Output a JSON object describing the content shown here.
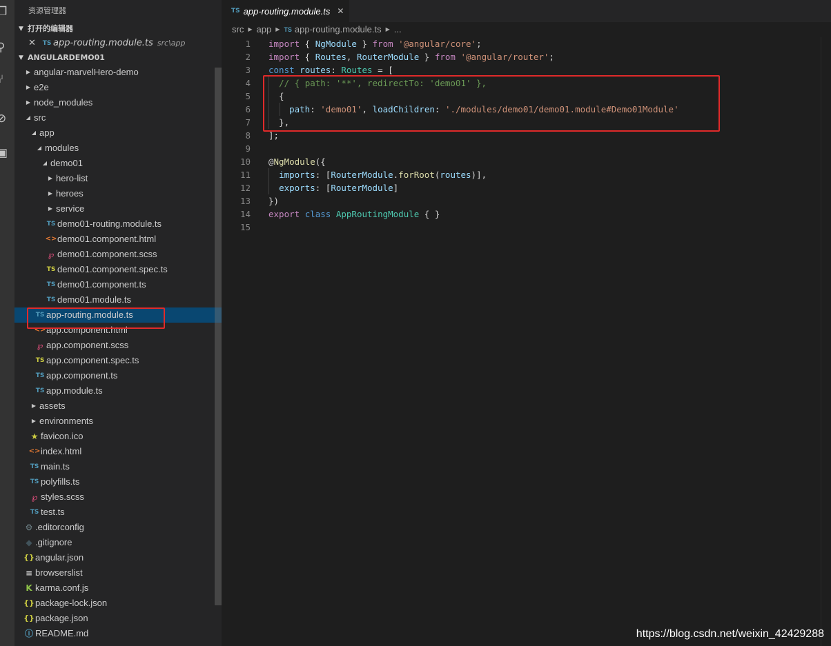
{
  "sidebar": {
    "title": "资源管理器",
    "open_editors_label": "打开的编辑器",
    "open_editor": {
      "name": "app-routing.module.ts",
      "path": "src\\app"
    },
    "project_label": "ANGULARDEMO01"
  },
  "tree": [
    {
      "name": "angular-marvelHero-demo",
      "type": "folder",
      "open": false
    },
    {
      "name": "e2e",
      "type": "folder",
      "open": false
    },
    {
      "name": "node_modules",
      "type": "folder",
      "open": false
    },
    {
      "name": "src",
      "type": "folder",
      "open": true
    },
    {
      "name": "app",
      "type": "folder",
      "open": true
    },
    {
      "name": "modules",
      "type": "folder",
      "open": true
    },
    {
      "name": "demo01",
      "type": "folder",
      "open": true
    },
    {
      "name": "hero-list",
      "type": "folder",
      "open": false
    },
    {
      "name": "heroes",
      "type": "folder",
      "open": false
    },
    {
      "name": "service",
      "type": "folder",
      "open": false
    },
    {
      "name": "demo01-routing.module.ts",
      "type": "ts"
    },
    {
      "name": "demo01.component.html",
      "type": "html"
    },
    {
      "name": "demo01.component.scss",
      "type": "scss"
    },
    {
      "name": "demo01.component.spec.ts",
      "type": "tsspec"
    },
    {
      "name": "demo01.component.ts",
      "type": "ts"
    },
    {
      "name": "demo01.module.ts",
      "type": "ts"
    },
    {
      "name": "app-routing.module.ts",
      "type": "ts",
      "selected": true
    },
    {
      "name": "app.component.html",
      "type": "html"
    },
    {
      "name": "app.component.scss",
      "type": "scss"
    },
    {
      "name": "app.component.spec.ts",
      "type": "tsspec"
    },
    {
      "name": "app.component.ts",
      "type": "ts"
    },
    {
      "name": "app.module.ts",
      "type": "ts"
    },
    {
      "name": "assets",
      "type": "folder",
      "open": false
    },
    {
      "name": "environments",
      "type": "folder",
      "open": false
    },
    {
      "name": "favicon.ico",
      "type": "fav"
    },
    {
      "name": "index.html",
      "type": "html"
    },
    {
      "name": "main.ts",
      "type": "ts"
    },
    {
      "name": "polyfills.ts",
      "type": "ts"
    },
    {
      "name": "styles.scss",
      "type": "scss"
    },
    {
      "name": "test.ts",
      "type": "ts"
    },
    {
      "name": ".editorconfig",
      "type": "gear"
    },
    {
      "name": ".gitignore",
      "type": "git"
    },
    {
      "name": "angular.json",
      "type": "json"
    },
    {
      "name": "browserslist",
      "type": "list"
    },
    {
      "name": "karma.conf.js",
      "type": "karma"
    },
    {
      "name": "package-lock.json",
      "type": "json"
    },
    {
      "name": "package.json",
      "type": "json"
    },
    {
      "name": "README.md",
      "type": "info"
    }
  ],
  "icons": {
    "ts": "TS",
    "tsspec": "TS",
    "html": "<>",
    "scss": "℘",
    "json": "{}",
    "fav": "★",
    "gear": "⚙",
    "git": "◆",
    "list": "≡",
    "karma": "K",
    "info": "ⓘ"
  },
  "tab": {
    "label": "app-routing.module.ts",
    "icon": "TS"
  },
  "breadcrumb": [
    "src",
    "app",
    "app-routing.module.ts",
    "..."
  ],
  "code_lines": [
    [
      [
        "kw",
        "import"
      ],
      [
        "pn",
        " { "
      ],
      [
        "var",
        "NgModule"
      ],
      [
        "pn",
        " } "
      ],
      [
        "kw",
        "from"
      ],
      [
        "pn",
        " "
      ],
      [
        "str",
        "'@angular/core'"
      ],
      [
        "pn",
        ";"
      ]
    ],
    [
      [
        "kw",
        "import"
      ],
      [
        "pn",
        " { "
      ],
      [
        "var",
        "Routes"
      ],
      [
        "pn",
        ", "
      ],
      [
        "var",
        "RouterModule"
      ],
      [
        "pn",
        " } "
      ],
      [
        "kw",
        "from"
      ],
      [
        "pn",
        " "
      ],
      [
        "str",
        "'@angular/router'"
      ],
      [
        "pn",
        ";"
      ]
    ],
    [
      [
        "kb",
        "const"
      ],
      [
        "pn",
        " "
      ],
      [
        "var",
        "routes"
      ],
      [
        "pn",
        ": "
      ],
      [
        "ty",
        "Routes"
      ],
      [
        "pn",
        " = ["
      ]
    ],
    [
      [
        "pn",
        "  "
      ],
      [
        "cm",
        "// { path: '**', redirectTo: 'demo01' },"
      ]
    ],
    [
      [
        "pn",
        "  {"
      ]
    ],
    [
      [
        "pn",
        "    "
      ],
      [
        "var",
        "path"
      ],
      [
        "pn",
        ": "
      ],
      [
        "str",
        "'demo01'"
      ],
      [
        "pn",
        ", "
      ],
      [
        "var",
        "loadChildren"
      ],
      [
        "pn",
        ": "
      ],
      [
        "str",
        "'./modules/demo01/demo01.module#Demo01Module'"
      ]
    ],
    [
      [
        "pn",
        "  },"
      ]
    ],
    [
      [
        "pn",
        "];"
      ]
    ],
    [],
    [
      [
        "pn",
        "@"
      ],
      [
        "fn",
        "NgModule"
      ],
      [
        "pn",
        "({"
      ]
    ],
    [
      [
        "pn",
        "  "
      ],
      [
        "var",
        "imports"
      ],
      [
        "pn",
        ": ["
      ],
      [
        "var",
        "RouterModule"
      ],
      [
        "pn",
        "."
      ],
      [
        "fn",
        "forRoot"
      ],
      [
        "pn",
        "("
      ],
      [
        "var",
        "routes"
      ],
      [
        "pn",
        ")],"
      ]
    ],
    [
      [
        "pn",
        "  "
      ],
      [
        "var",
        "exports"
      ],
      [
        "pn",
        ": ["
      ],
      [
        "var",
        "RouterModule"
      ],
      [
        "pn",
        "]"
      ]
    ],
    [
      [
        "pn",
        "})"
      ]
    ],
    [
      [
        "kw",
        "export"
      ],
      [
        "pn",
        " "
      ],
      [
        "kb",
        "class"
      ],
      [
        "pn",
        " "
      ],
      [
        "ty",
        "AppRoutingModule"
      ],
      [
        "pn",
        " { }"
      ]
    ],
    []
  ],
  "watermark": "https://blog.csdn.net/weixin_42429288"
}
